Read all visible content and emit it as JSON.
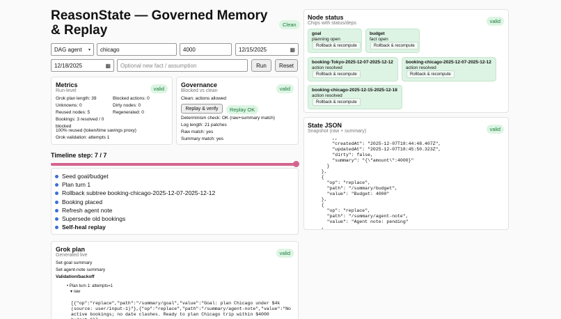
{
  "header": {
    "title": "ReasonState — Governed Memory & Replay",
    "badge": "Clean"
  },
  "controls": {
    "agent_select": "DAG agent",
    "city_value": "chicago",
    "budget_value": "4000",
    "start_date": "12/15/2025",
    "end_date": "12/18/2025",
    "fact_placeholder": "Optional new fact / assumption",
    "run_label": "Run",
    "reset_label": "Reset"
  },
  "metrics": {
    "title": "Metrics",
    "subtitle": "Run-level",
    "badge": "valid",
    "grok_plan_length": "Grok plan length: 39",
    "unknowns": "Unknowns: 0",
    "reused_nodes": "Reused nodes: 5",
    "bookings": "Bookings: 3 resolved / 0 blocked",
    "reused_pct": "100% reused (token/time savings proxy)",
    "grok_validation": "Grok validation: attempts 1",
    "blocked_actions": "Blocked actions: 0",
    "dirty_nodes": "Dirty nodes: 0",
    "regenerated": "Regenerated: 0"
  },
  "governance": {
    "title": "Governance",
    "subtitle": "Blocked vs clean",
    "badge": "valid",
    "clean_text": "Clean: actions allowed",
    "replay_label": "Replay & verify",
    "replay_status": "Replay OK",
    "determinism": "Determinism check: OK (raw+summary match)",
    "log_length": "Log length: 21 patches",
    "raw_match": "Raw match: yes",
    "summary_match": "Summary match: yes"
  },
  "timeline": {
    "title": "Timeline step: 7 / 7",
    "current_step": 7,
    "total_steps": 7,
    "steps": [
      "Seed goal/budget",
      "Plan turn 1",
      "Rollback subtree booking-chicago-2025-12-07-2025-12-12",
      "Booking placed",
      "Refresh agent note",
      "Supersede old bookings",
      "Self-heal replay"
    ]
  },
  "grok_plan": {
    "title": "Grok plan",
    "subtitle": "Generated live",
    "badge": "valid",
    "lines": [
      "Set goal summary",
      "Set agent-note summary"
    ],
    "validation_heading": "Validation/backoff",
    "attempt": "Plan turn 1: attempts=1",
    "raw_toggle": "▾ raw",
    "raw_text": "[{\"op\":\"replace\",\"path\":\"/summary/goal\",\"value\":\"Goal: plan Chicago under $4k (source: user/input-1)\"},{\"op\":\"replace\",\"path\":\"/summary/agent-note\",\"value\":\"No active bookings; no date clashes. Ready to plan Chicago trip within $4000 budget.\"}]"
  },
  "node_status": {
    "title": "Node status",
    "subtitle": "Chips with status/deps",
    "badge": "valid",
    "chips": [
      {
        "name": "goal",
        "status": "planning open",
        "action": "Rollback & recompute"
      },
      {
        "name": "budget",
        "status": "fact open",
        "action": "Rollback & recompute"
      },
      {
        "name": "booking-Tokyo-2025-12-07-2025-12-12",
        "status": "action resolved",
        "action": "Rollback & recompute"
      },
      {
        "name": "booking-chicago-2025-12-07-2025-12-12",
        "status": "action resolved",
        "action": "Rollback & recompute"
      },
      {
        "name": "booking-chicago-2025-12-15-2025-12-18",
        "status": "action resolved",
        "action": "Rollback & recompute"
      }
    ]
  },
  "state_json": {
    "title": "State JSON",
    "subtitle": "Snapshot (raw + summary)",
    "badge": "valid",
    "text": "      ,,\n      \"createdAt\": \"2025-12-07T18:44:48.407Z\",\n      \"updatedAt\": \"2025-12-07T18:45:50.323Z\",\n      \"dirty\": false,\n      \"summary\": \"{\\\"amount\\\":4000}\"\n    }\n  },\n  {\n    \"op\": \"replace\",\n    \"path\": \"/summary/budget\",\n    \"value\": \"Budget: 4000\"\n  },\n  {\n    \"op\": \"replace\",\n    \"path\": \"/summary/agent-note\",\n    \"value\": \"Agent note: pending\"\n  ,"
  },
  "colors": {
    "accent": "#d4648f",
    "valid_bg": "#dcf5e3",
    "valid_fg": "#1e7a3c",
    "bullet": "#3b6fd6"
  }
}
